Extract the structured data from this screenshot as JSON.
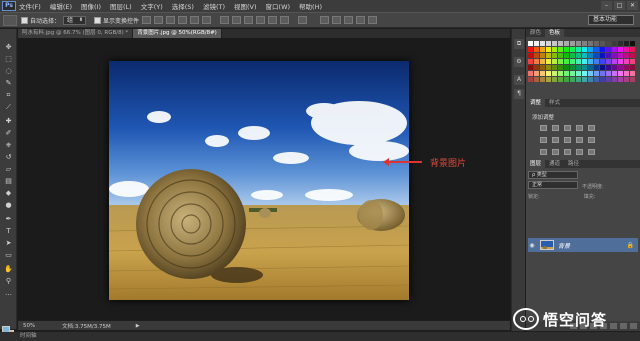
{
  "app": {
    "logo": "Ps"
  },
  "menu": [
    "文件(F)",
    "编辑(E)",
    "图像(I)",
    "图层(L)",
    "文字(Y)",
    "选择(S)",
    "滤镜(T)",
    "视图(V)",
    "窗口(W)",
    "帮助(H)"
  ],
  "window_controls": [
    "minimize-icon",
    "restore-icon",
    "close-icon"
  ],
  "options": {
    "auto_select_label": "自动选择：",
    "auto_select_value": "组",
    "show_transform_label": "显示变换控件",
    "workspace": "基本功能"
  },
  "tabs": [
    {
      "label": "阿水有料.jpg @ 66.7% (图层 0, RGB/8) *",
      "active": false
    },
    {
      "label": "背景图片.jpg @ 50%(RGB/8#)",
      "active": true
    }
  ],
  "annotation": {
    "text": "背景图片",
    "color": "#e24a3c"
  },
  "status": {
    "zoom": "50%",
    "doc": "文档:3.75M/3.75M",
    "arrow": "▶"
  },
  "mini": {
    "label": "时间轴"
  },
  "panels": {
    "color_tabs": [
      "颜色",
      "色板"
    ],
    "adjust_tabs": [
      "调整",
      "样式"
    ],
    "adjust_title": "添加调整",
    "layer_tabs": [
      "图层",
      "通道",
      "路径"
    ],
    "kind_label": "ρ 类型",
    "blend_mode": "正常",
    "opacity_label": "不透明度:",
    "lock_label": "锁定:",
    "fill_label": "填充:",
    "layer_name": "背景"
  },
  "watermark": {
    "text": "悟空问答"
  },
  "colors": {
    "fg": "#7fb7d8",
    "bg": "#f2a877"
  }
}
